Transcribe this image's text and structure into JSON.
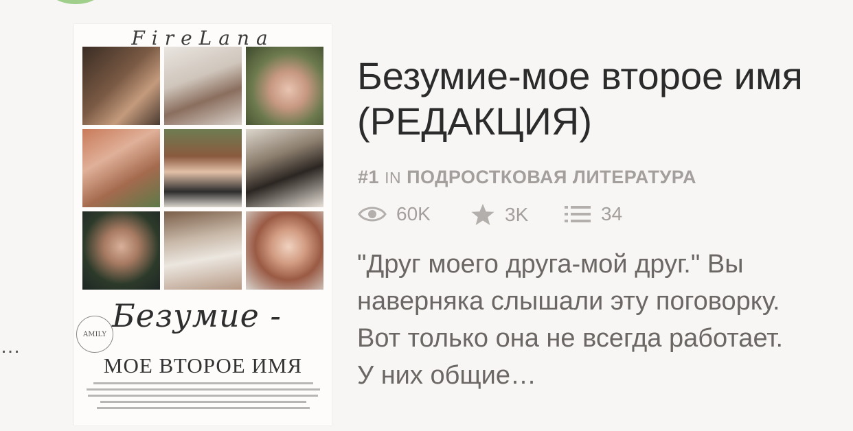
{
  "story": {
    "title": "Безумие-мое второе имя (РЕДАКЦИЯ)",
    "rank": {
      "number": "#1",
      "in_label": "IN",
      "category": "ПОДРОСТКОВАЯ ЛИТЕРАТУРА"
    },
    "stats": {
      "reads": {
        "icon": "eye-icon",
        "value": "60K"
      },
      "votes": {
        "icon": "star-icon",
        "value": "3K"
      },
      "parts": {
        "icon": "list-icon",
        "value": "34"
      }
    },
    "description": "\"Друг моего друга-мой друг.\" Вы наверняка слышали эту поговорку. Вот только она не всегда работает. У них общие…"
  },
  "cover": {
    "author": "FireLana",
    "script_title": "Безумие -",
    "stamp": "AMILY",
    "subtitle": "МОЕ ВТОРОЕ ИМЯ"
  },
  "side_ellipsis": "…",
  "colors": {
    "background": "#f8f6f4",
    "title": "#2b2b2b",
    "meta": "#a39f9c",
    "description": "#6b6764"
  }
}
